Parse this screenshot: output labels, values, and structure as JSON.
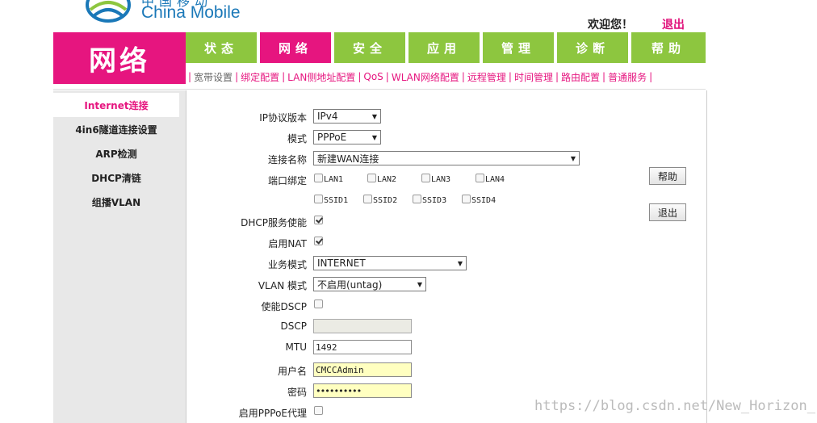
{
  "header": {
    "logo_cn": "中国移动",
    "logo_en": "China Mobile",
    "welcome": "欢迎您！",
    "logout": "退出"
  },
  "section_title": "网络",
  "tabs": [
    {
      "label": "状态"
    },
    {
      "label": "网络",
      "active": true
    },
    {
      "label": "安全"
    },
    {
      "label": "应用"
    },
    {
      "label": "管理"
    },
    {
      "label": "诊断"
    },
    {
      "label": "帮助"
    }
  ],
  "subnav": [
    "宽带设置",
    "绑定配置",
    "LAN侧地址配置",
    "QoS",
    "WLAN网络配置",
    "远程管理",
    "时间管理",
    "路由配置",
    "普通服务"
  ],
  "leftnav": [
    "Internet连接",
    "4in6隧道连接设置",
    "ARP检测",
    "DHCP清链",
    "组播VLAN"
  ],
  "form": {
    "ip_version_label": "IP协议版本",
    "ip_version_value": "IPv4",
    "mode_label": "模式",
    "mode_value": "PPPoE",
    "conn_name_label": "连接名称",
    "conn_name_value": "新建WAN连接",
    "port_bind_label": "端口绑定",
    "ports_lan": [
      "LAN1",
      "LAN2",
      "LAN3",
      "LAN4"
    ],
    "ports_ssid": [
      "SSID1",
      "SSID2",
      "SSID3",
      "SSID4"
    ],
    "dhcp_label": "DHCP服务使能",
    "dhcp_checked": true,
    "nat_label": "启用NAT",
    "nat_checked": true,
    "service_mode_label": "业务模式",
    "service_mode_value": "INTERNET",
    "vlan_mode_label": "VLAN 模式",
    "vlan_mode_value": "不启用(untag)",
    "enable_dscp_label": "使能DSCP",
    "enable_dscp_checked": false,
    "dscp_label": "DSCP",
    "dscp_value": "",
    "mtu_label": "MTU",
    "mtu_value": "1492",
    "username_label": "用户名",
    "username_value": "CMCCAdmin",
    "password_label": "密码",
    "password_value": "••••••••••",
    "pppoe_proxy_label": "启用PPPoE代理",
    "pppoe_proxy_checked": false
  },
  "buttons": {
    "help": "帮助",
    "exit": "退出"
  },
  "watermark": "https://blog.csdn.net/New_Horizon_",
  "colors": {
    "magenta": "#e6157f",
    "green": "#8dc63f",
    "brand_blue": "#1a78b8"
  }
}
